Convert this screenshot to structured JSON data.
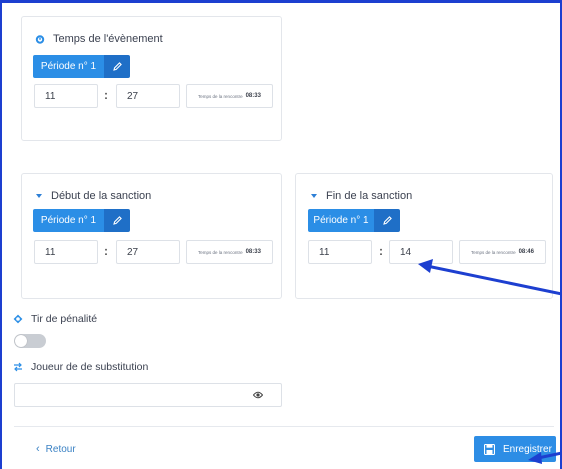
{
  "event_time": {
    "title": "Temps de l'évènement",
    "period_label": "Période n° 1",
    "minutes": "11",
    "seconds": "27",
    "match_time_label": "Temps de la rencontre",
    "match_time_value": "08:33"
  },
  "penalty_start": {
    "title": "Début de la sanction",
    "period_label": "Période n° 1",
    "minutes": "11",
    "seconds": "27",
    "match_time_label": "Temps de la rencontre",
    "match_time_value": "08:33"
  },
  "penalty_end": {
    "title": "Fin de la sanction",
    "period_label": "Période n° 1",
    "minutes": "11",
    "seconds": "14",
    "match_time_label": "Temps de la rencontre",
    "match_time_value": "08:46"
  },
  "penalty_shot": {
    "label": "Tir de pénalité",
    "enabled": false
  },
  "substitute": {
    "label": "Joueur de de substitution",
    "value": ""
  },
  "footer": {
    "back_label": "Retour",
    "save_label": "Enregistrer"
  },
  "colors": {
    "primary": "#2b8ee6",
    "primary_dark": "#1f6fc7",
    "annotation_arrow": "#1d3fd0"
  },
  "icons": {
    "event_time": "stopwatch-icon",
    "caret": "caret-down-icon",
    "edit": "pencil-icon",
    "penalty_shot": "target-icon",
    "substitute": "swap-icon",
    "visibility": "eye-icon",
    "back": "chevron-left-icon",
    "save": "floppy-disk-icon"
  }
}
